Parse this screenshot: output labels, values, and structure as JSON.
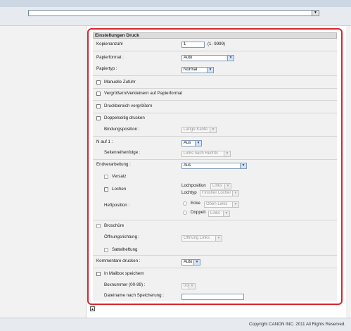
{
  "top": {
    "select_arrow": "▼"
  },
  "section": {
    "title": "Einstellungen Druck"
  },
  "kopien": {
    "label": "Kopienanzahl",
    "value": "1",
    "range": "(1- 9999)"
  },
  "papierformat": {
    "label": "Papierformat :",
    "value": "Auto"
  },
  "papiertyp": {
    "label": "Papiertyp :",
    "value": "Normal"
  },
  "manuelle": {
    "label": "Manuelle Zufuhr"
  },
  "vergroessern": {
    "label": "Vergrößern/Verkleinern auf Papierformat"
  },
  "druckbereich": {
    "label": "Druckbereich vergrößern"
  },
  "doppelseitig": {
    "label": "Doppelseitig drucken"
  },
  "bindung": {
    "label": "Bindungsposition :",
    "value": "Lange Kante"
  },
  "nauf1": {
    "label": "N auf 1 :",
    "value": "Aus"
  },
  "seitenreihenfolge": {
    "label": "Seitenreihenfolge :",
    "value": "Links nach Rechts"
  },
  "endverarbeitung": {
    "label": "Endverarbeitung :",
    "value": "Aus"
  },
  "versatz": {
    "label": "Versatz"
  },
  "lochen": {
    "label": "Lochen",
    "lochposition_label": "Lochposition",
    "lochposition_value": "Links",
    "lochtyp_label": "Lochtyp",
    "lochtyp_value": "Finisher Locher"
  },
  "heftposition": {
    "label": "Heftposition :",
    "ecke_label": "Ecke",
    "ecke_value": "Oben Links",
    "doppelt_label": "Doppelt",
    "doppelt_value": "Links"
  },
  "broschuere": {
    "label": "Broschüre"
  },
  "oeffnung": {
    "label": "Öffnungsrichtung :",
    "value": "Öffnung Links"
  },
  "sattel": {
    "label": "Sattelheftung"
  },
  "kommentare": {
    "label": "Kommentare drucken :",
    "value": "Auto"
  },
  "mailbox": {
    "label": "In Mailbox speichern",
    "boxnummer_label": "Boxnummer (00-99) :",
    "boxnummer_value": "00",
    "dateiname_label": "Dateiname nach Speicherung :",
    "dateiname_value": ""
  },
  "footer": {
    "copyright": "Copyright CANON INC. 2011 All Rights Reserved."
  },
  "colors": {
    "panel_border": "#d9252b",
    "header_band": "#ccd7e3",
    "select_border": "#7f9db9"
  }
}
